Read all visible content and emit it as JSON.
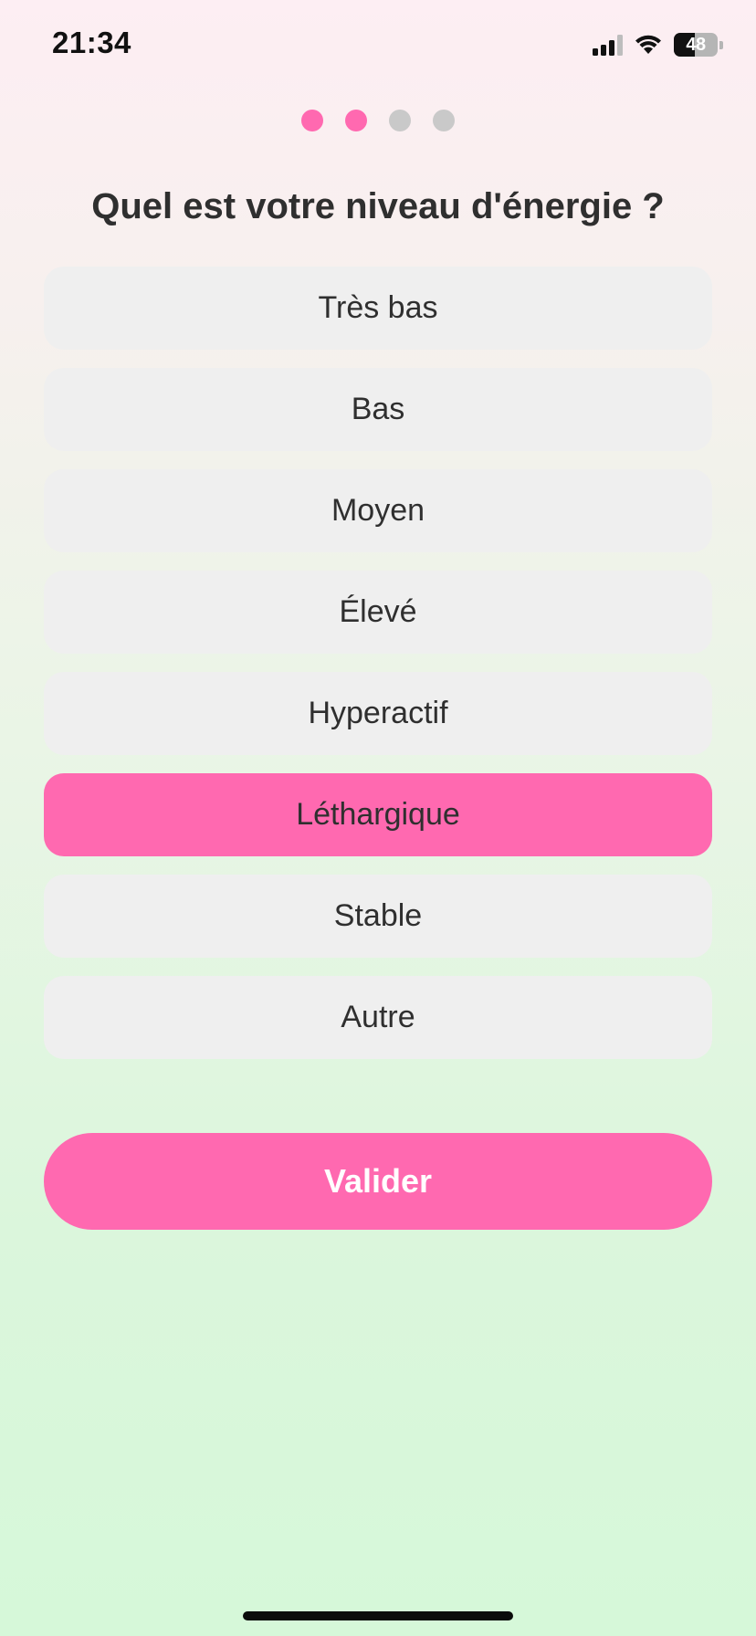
{
  "status_bar": {
    "time": "21:34",
    "battery_level": "48",
    "battery_fraction": 0.48,
    "icons": [
      "signal-icon",
      "wifi-icon",
      "battery-icon"
    ]
  },
  "progress": {
    "total_steps": 4,
    "current_step": 2,
    "active_color": "#ff69b0",
    "inactive_color": "#c9c9c9"
  },
  "question": {
    "title": "Quel est votre niveau d'énergie ?"
  },
  "options": [
    {
      "label": "Très bas",
      "selected": false
    },
    {
      "label": "Bas",
      "selected": false
    },
    {
      "label": "Moyen",
      "selected": false
    },
    {
      "label": "Élevé",
      "selected": false
    },
    {
      "label": "Hyperactif",
      "selected": false
    },
    {
      "label": "Léthargique",
      "selected": true
    },
    {
      "label": "Stable",
      "selected": false
    },
    {
      "label": "Autre",
      "selected": false
    }
  ],
  "actions": {
    "validate_label": "Valider"
  },
  "colors": {
    "accent": "#ff69b0",
    "option_background": "#efefef",
    "text": "#2f2f2f"
  }
}
